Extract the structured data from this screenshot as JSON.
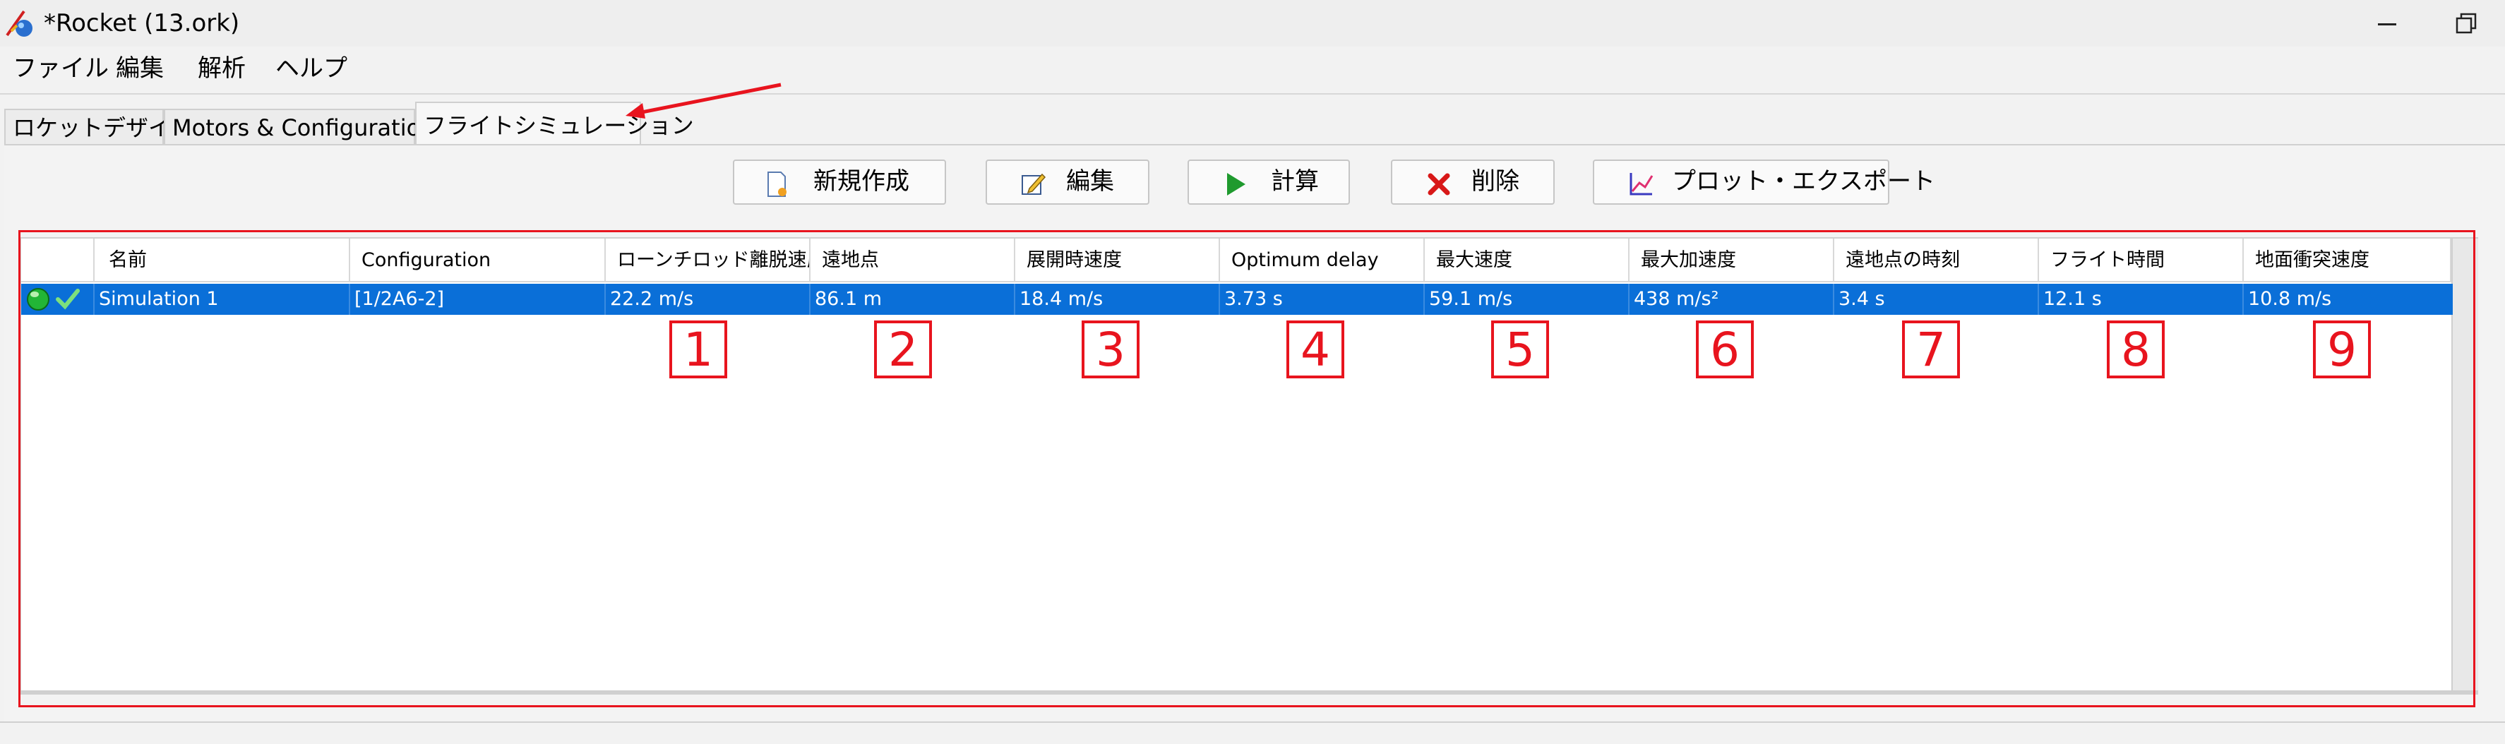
{
  "window": {
    "title": "*Rocket (13.ork)"
  },
  "menubar": {
    "items": [
      "ファイル",
      "編集",
      "解析",
      "ヘルプ"
    ]
  },
  "tabs": [
    {
      "label": "ロケットデザイン",
      "selected": false
    },
    {
      "label": "Motors & Configuration",
      "selected": false
    },
    {
      "label": "フライトシミュレーション",
      "selected": true
    }
  ],
  "toolbar": {
    "new_label": "新規作成",
    "edit_label": "編集",
    "run_label": "計算",
    "delete_label": "削除",
    "plot_label": "プロット・エクスポート"
  },
  "table": {
    "columns": [
      "",
      "名前",
      "Configuration",
      "ローンチロッド離脱速度",
      "遠地点",
      "展開時速度",
      "Optimum delay",
      "最大速度",
      "最大加速度",
      "遠地点の時刻",
      "フライト時間",
      "地面衝突速度"
    ],
    "rows": [
      {
        "status": "ok",
        "name": "Simulation 1",
        "configuration": "[1/2A6-2]",
        "launch_rod_velocity": "22.2 m/s",
        "apogee": "86.1 m",
        "deployment_velocity": "18.4 m/s",
        "optimum_delay": "3.73 s",
        "max_velocity": "59.1 m/s",
        "max_acceleration": "438 m/s²",
        "time_to_apogee": "3.4 s",
        "flight_time": "12.1 s",
        "ground_hit_velocity": "10.8 m/s",
        "selected": true
      }
    ]
  },
  "annotations": {
    "numbers": [
      "1",
      "2",
      "3",
      "4",
      "5",
      "6",
      "7",
      "8",
      "9"
    ],
    "color": "#e8141e"
  },
  "colors": {
    "selection": "#0a6fd8",
    "highlight": "#e8141e"
  }
}
